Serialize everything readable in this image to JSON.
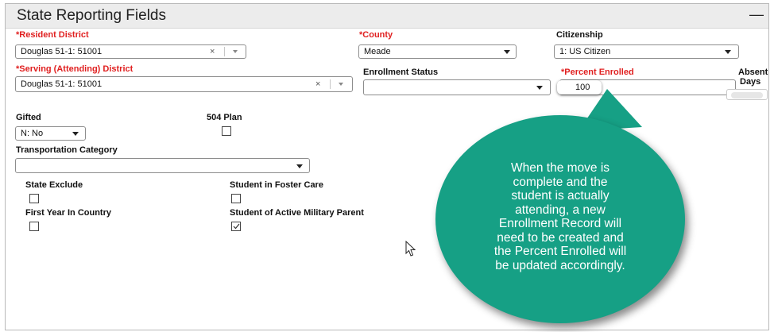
{
  "panel": {
    "title": "State Reporting Fields",
    "collapse_symbol": "—"
  },
  "fields": {
    "resident_district": {
      "label": "*Resident District",
      "value": "Douglas 51-1: 51001"
    },
    "county": {
      "label": "*County",
      "value": "Meade"
    },
    "citizenship": {
      "label": "Citizenship",
      "value": "1: US Citizen"
    },
    "serving_district": {
      "label": "*Serving (Attending) District",
      "value": "Douglas 51-1: 51001"
    },
    "enrollment_status": {
      "label": "Enrollment Status",
      "value": ""
    },
    "percent_enrolled": {
      "label": "*Percent Enrolled",
      "value": "100"
    },
    "absent_days": {
      "label_line1": "Absent",
      "label_line2": "Days",
      "value": ""
    },
    "gifted": {
      "label": "Gifted",
      "value": "N: No"
    },
    "plan_504": {
      "label": "504 Plan",
      "checked": false
    },
    "transportation_category": {
      "label": "Transportation Category",
      "value": ""
    },
    "state_exclude": {
      "label": "State Exclude",
      "checked": false
    },
    "student_in_foster_care": {
      "label": "Student in Foster Care",
      "checked": false
    },
    "first_year_in_country": {
      "label": "First Year In Country",
      "checked": false
    },
    "student_of_active_military_parent": {
      "label": "Student of Active Military Parent",
      "checked": true
    }
  },
  "icons": {
    "clear": "×",
    "dropdown": "chevron-down-icon",
    "cursor": "mouse-pointer-icon"
  },
  "callout": {
    "text": "When the move is\ncomplete and the\nstudent is actually\nattending, a new\nEnrollment Record will\nneed to be created and\nthe Percent Enrolled will\nbe updated accordingly."
  },
  "colors": {
    "required_label": "#e02020",
    "callout_fill": "#16a085",
    "header_bg": "#ececec"
  }
}
